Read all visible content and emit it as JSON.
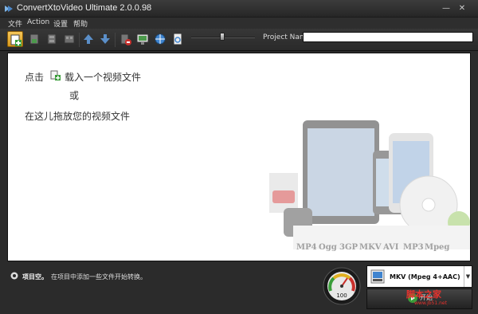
{
  "window": {
    "title": "ConvertXtoVideo Ultimate 2.0.0.98",
    "minimize_icon": "minimize-icon",
    "close_icon": "close-icon"
  },
  "menu": [
    "文件",
    "Action",
    "设置",
    "帮助"
  ],
  "toolbar": {
    "project_name_label": "Project Name",
    "project_name_value": "",
    "buttons": [
      "add-video-icon",
      "save-icon",
      "film-icon",
      "film-grid-icon",
      "move-up-icon",
      "move-down-icon",
      "delete-icon",
      "monitor-icon",
      "globe-icon",
      "document-icon"
    ]
  },
  "main": {
    "hint_prefix": "点击",
    "hint_add": "载入一个视频文件",
    "hint_or": "或",
    "hint_drag": "在这儿拖放您的视频文件",
    "formats": [
      "MP4",
      "Ogg",
      "3GP",
      "MKV",
      "AVI",
      "MP3",
      "Mpeg"
    ]
  },
  "status": {
    "label": "项目空。",
    "message": "在项目中添加一些文件开始转换。",
    "gauge_value": "100",
    "format_selected": "MKV (Mpeg 4+AAC)",
    "start_label": "开始",
    "watermark": "脚本之家",
    "watermark_sub": "www.jb51.net"
  },
  "colors": {
    "accent": "#f0b43a",
    "background": "#2b2b2b",
    "canvas": "#ffffff"
  }
}
